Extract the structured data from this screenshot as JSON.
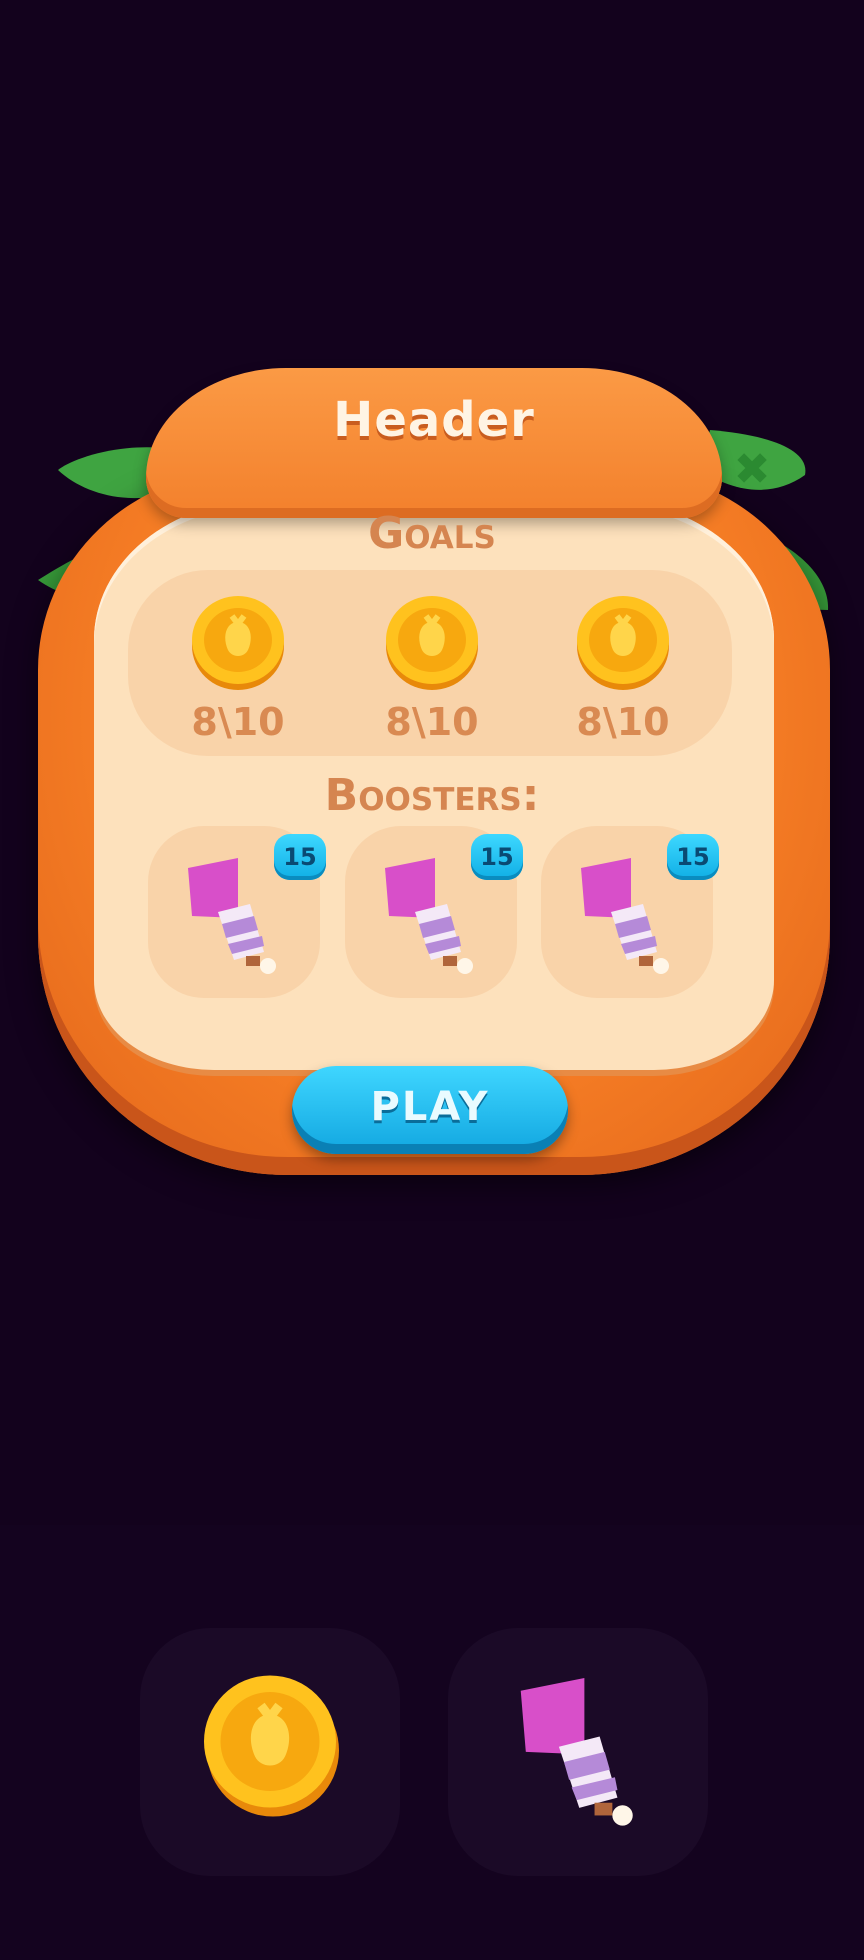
{
  "popup": {
    "header": "Header",
    "close_icon": "close-icon",
    "goals_title": "Goals",
    "goals": [
      {
        "icon": "carrot-coin-icon",
        "count": "8\\10"
      },
      {
        "icon": "carrot-coin-icon",
        "count": "8\\10"
      },
      {
        "icon": "carrot-coin-icon",
        "count": "8\\10"
      }
    ],
    "boosters_title": "Boosters:",
    "boosters": [
      {
        "icon": "rocket-booster-icon",
        "badge": "15"
      },
      {
        "icon": "rocket-booster-icon",
        "badge": "15"
      },
      {
        "icon": "rocket-booster-icon",
        "badge": "15"
      }
    ],
    "play_label": "PLAY"
  },
  "preview_icons": [
    "carrot-coin-icon",
    "rocket-booster-icon"
  ],
  "colors": {
    "background": "#13021d",
    "panel_orange": "#f47b24",
    "panel_cream": "#fde1bc",
    "play_blue": "#1bb4ea",
    "leaf_green": "#3fa441",
    "text_brown": "#d58550"
  }
}
